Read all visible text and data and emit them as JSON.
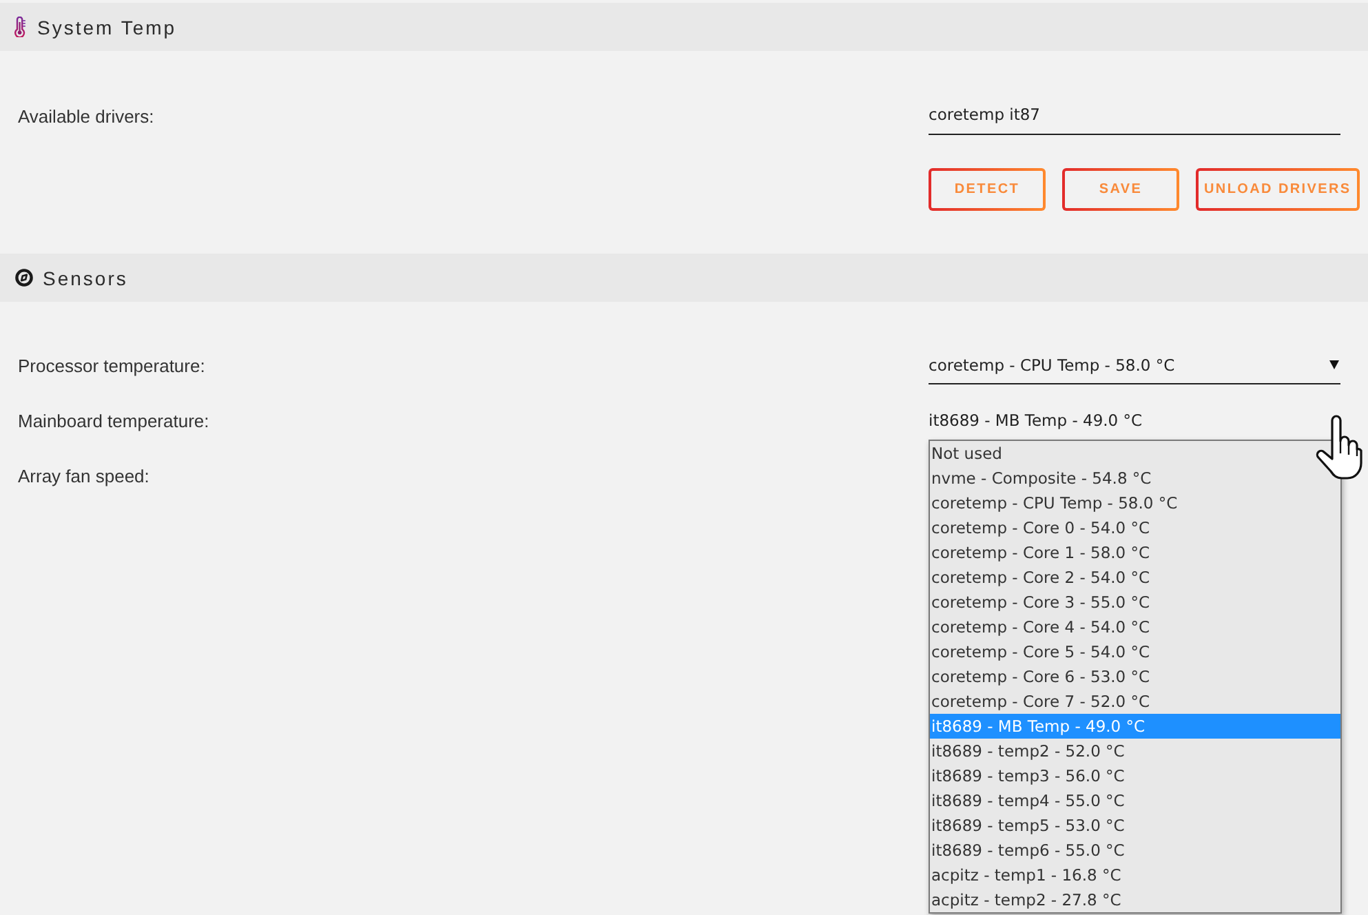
{
  "system_temp": {
    "title": "System Temp",
    "drivers_label": "Available drivers:",
    "drivers_value": "coretemp it87",
    "buttons": [
      "DETECT",
      "SAVE",
      "UNLOAD DRIVERS"
    ]
  },
  "sensors": {
    "title": "Sensors",
    "rows": [
      {
        "label": "Processor temperature:",
        "value": "coretemp - CPU Temp - 58.0 °C",
        "expanded": false
      },
      {
        "label": "Mainboard temperature:",
        "value": "it8689 - MB Temp - 49.0 °C",
        "expanded": true,
        "options": [
          {
            "label": "Not used",
            "selected": false
          },
          {
            "label": "nvme - Composite - 54.8 °C",
            "selected": false
          },
          {
            "label": "coretemp - CPU Temp - 58.0 °C",
            "selected": false
          },
          {
            "label": "coretemp - Core 0 - 54.0 °C",
            "selected": false
          },
          {
            "label": "coretemp - Core 1 - 58.0 °C",
            "selected": false
          },
          {
            "label": "coretemp - Core 2 - 54.0 °C",
            "selected": false
          },
          {
            "label": "coretemp - Core 3 - 55.0 °C",
            "selected": false
          },
          {
            "label": "coretemp - Core 4 - 54.0 °C",
            "selected": false
          },
          {
            "label": "coretemp - Core 5 - 54.0 °C",
            "selected": false
          },
          {
            "label": "coretemp - Core 6 - 53.0 °C",
            "selected": false
          },
          {
            "label": "coretemp - Core 7 - 52.0 °C",
            "selected": false
          },
          {
            "label": "it8689 - MB Temp - 49.0 °C",
            "selected": true
          },
          {
            "label": "it8689 - temp2 - 52.0 °C",
            "selected": false
          },
          {
            "label": "it8689 - temp3 - 56.0 °C",
            "selected": false
          },
          {
            "label": "it8689 - temp4 - 55.0 °C",
            "selected": false
          },
          {
            "label": "it8689 - temp5 - 53.0 °C",
            "selected": false
          },
          {
            "label": "it8689 - temp6 - 55.0 °C",
            "selected": false
          },
          {
            "label": "acpitz - temp1 - 16.8 °C",
            "selected": false
          },
          {
            "label": "acpitz - temp2 - 27.8 °C",
            "selected": false
          }
        ]
      },
      {
        "label": "Array fan speed:"
      }
    ]
  }
}
